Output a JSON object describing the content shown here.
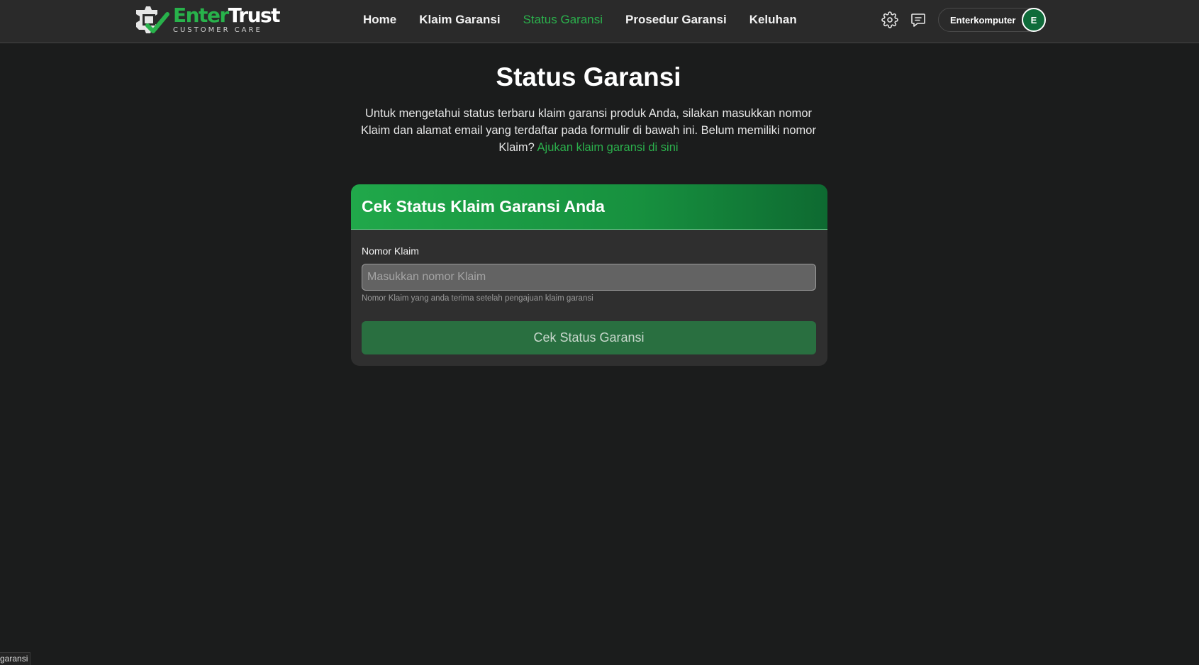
{
  "header": {
    "logo": {
      "brand_part1": "Enter",
      "brand_part2": "Trust",
      "subtitle": "CUSTOMER CARE",
      "accent_color": "#28b24b"
    },
    "nav": [
      {
        "label": "Home",
        "active": false
      },
      {
        "label": "Klaim Garansi",
        "active": false
      },
      {
        "label": "Status Garansi",
        "active": true
      },
      {
        "label": "Prosedur Garansi",
        "active": false
      },
      {
        "label": "Keluhan",
        "active": false
      }
    ],
    "icons": [
      "gear-icon",
      "chat-icon"
    ],
    "user": {
      "name": "Enterkomputer",
      "avatar_initial": "E",
      "avatar_color": "#0f6b3a"
    }
  },
  "main": {
    "title": "Status Garansi",
    "intro_text": "Untuk mengetahui status terbaru klaim garansi produk Anda, silakan masukkan nomor Klaim dan alamat email yang terdaftar pada formulir di bawah ini. Belum memiliki nomor Klaim?",
    "intro_link": "Ajukan klaim garansi di sini",
    "card": {
      "title": "Cek Status Klaim Garansi Anda",
      "field_label": "Nomor Klaim",
      "field_value": "",
      "field_placeholder": "Masukkan nomor Klaim",
      "field_help": "Nomor Klaim yang anda terima setelah pengajuan klaim garansi",
      "submit_label": "Cek Status Garansi"
    }
  },
  "status_bar": {
    "text": "garansi"
  },
  "colors": {
    "background": "#1b1c1c",
    "header": "#2a2a2a",
    "accent": "#2bb04c",
    "card": "#2f2f2f",
    "button": "#296f40"
  }
}
